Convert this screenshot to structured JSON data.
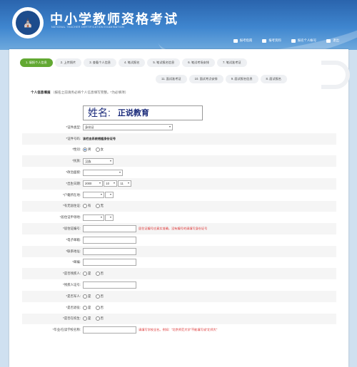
{
  "header": {
    "title": "中小学教师资格考试",
    "subtitle": "NATIONAL TEACHER CERTIFICATION EXAMINATION",
    "links": [
      "报考指南",
      "报考资料",
      "报名个人帐号",
      "退出"
    ]
  },
  "steps_row1": [
    "1. 填报个人信息",
    "2. 上传照片",
    "3. 查看个人信息",
    "4. 笔试报名",
    "5. 笔试报名信息",
    "6. 笔试考场安排",
    "7. 笔试准考证"
  ],
  "steps_row2": [
    "11. 面试准考证",
    "10. 面试考点安排",
    "9. 面试报名信息",
    "8. 面试报名"
  ],
  "section": {
    "title": "个人信息填报",
    "note": "（报名之前请务必将个人信息填写完整。*为必填项）"
  },
  "name": {
    "label": "姓名:",
    "value": "正说教育"
  },
  "fields": {
    "id_type": {
      "label": "*证件类型:",
      "value": "身份证"
    },
    "id_number": {
      "label": "*证件号码:",
      "value": "该栏由系统根据身份证号"
    },
    "gender": {
      "label": "*性别:",
      "opt1": "男",
      "opt2": "女"
    },
    "ethnicity": {
      "label": "*民族:",
      "value": "汉族"
    },
    "political": {
      "label": "*政治面貌:"
    },
    "birth": {
      "label": "*出生日期:",
      "year": "2000",
      "month": "10",
      "day": "11"
    },
    "hukou": {
      "label": "*户籍所在地:"
    },
    "residence_permit": {
      "label": "*有无居住证:",
      "opt1": "有",
      "opt2": "无"
    },
    "permit_place": {
      "label": "*居住证申领地:"
    },
    "permit_no": {
      "label": "*居住证编号:",
      "hint": "居住证编号应真实准确，没有编号的请填写身份证号"
    },
    "email": {
      "label": "*电子邮箱:"
    },
    "address": {
      "label": "*联系地址:"
    },
    "postcode": {
      "label": "*邮编:"
    },
    "disabled": {
      "label": "*是否残疾人:",
      "opt1": "是",
      "opt2": "否"
    },
    "disability_cert": {
      "label": "*残疾人证号:"
    },
    "military": {
      "label": "*是否军人:",
      "opt1": "是",
      "opt2": "否"
    },
    "retired": {
      "label": "*是否退役:",
      "opt1": "是",
      "opt2": "否"
    },
    "student": {
      "label": "*是否在校生:",
      "opt1": "是",
      "opt2": "否"
    },
    "school": {
      "label": "*毕业/在读学校名称:",
      "hint": "请填写学校全名。例如：“北京师范大学”不能填写成“北师大”"
    }
  }
}
